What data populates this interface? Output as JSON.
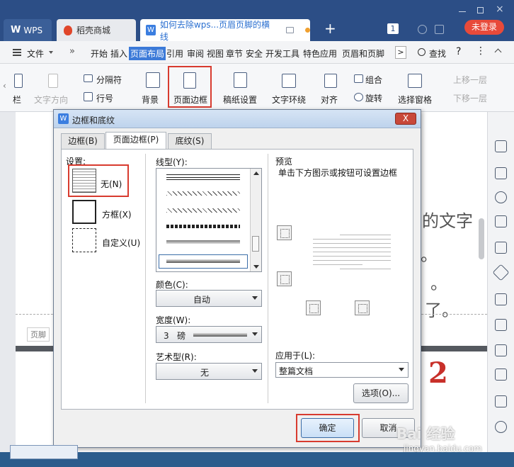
{
  "app": {
    "wps_tab": "WPS",
    "daoke_tab": "稻壳商城",
    "doc_tab": "如何去除wps...页眉页脚的横线",
    "new_tab": "+",
    "login_button": "未登录",
    "badge": "1"
  },
  "menu": {
    "file": "文件",
    "items": [
      "开始",
      "插入",
      "页面布局",
      "引用",
      "审阅",
      "视图",
      "章节",
      "安全",
      "开发工具",
      "特色应用",
      "页眉和页脚"
    ],
    "find": "查找",
    "help": "?"
  },
  "ribbon": {
    "col": "栏",
    "text_dir": "文字方向",
    "separator": "分隔符",
    "line_no": "行号",
    "background": "背景",
    "page_border": "页面边框",
    "manuscript": "稿纸设置",
    "text_wrap": "文字环绕",
    "align": "对齐",
    "group": "组合",
    "rotate": "旋转",
    "selection_pane": "选择窗格",
    "bring_forward": "上移一层",
    "send_backward": "下移一层"
  },
  "doc": {
    "footer_label": "页脚",
    "text_1": "的文字",
    "text_2": "。",
    "text_3": "了。",
    "text_4": "。",
    "page_no": "2"
  },
  "dialog": {
    "title": "边框和底纹",
    "close": "X",
    "tabs": [
      "边框(B)",
      "页面边框(P)",
      "底纹(S)"
    ],
    "settings_label": "设置:",
    "settings": [
      {
        "label": "无(N)"
      },
      {
        "label": "方框(X)"
      },
      {
        "label": "自定义(U)"
      }
    ],
    "line_style_label": "线型(Y):",
    "color_label": "颜色(C):",
    "color_value": "自动",
    "width_label": "宽度(W):",
    "width_value": "3   磅",
    "art_label": "艺术型(R):",
    "art_value": "无",
    "preview_label": "预览",
    "preview_hint": "单击下方图示或按钮可设置边框",
    "apply_label": "应用于(L):",
    "apply_value": "整篇文档",
    "options_button": "选项(O)...",
    "ok_button": "确定",
    "cancel_button": "取消"
  },
  "watermark": {
    "logo": "Bai 经验",
    "url": "jingyan.baidu.com"
  },
  "colors": {
    "highlight": "#d83b2f",
    "accent": "#3c7ad8",
    "title_bar": "#2c4e86"
  }
}
